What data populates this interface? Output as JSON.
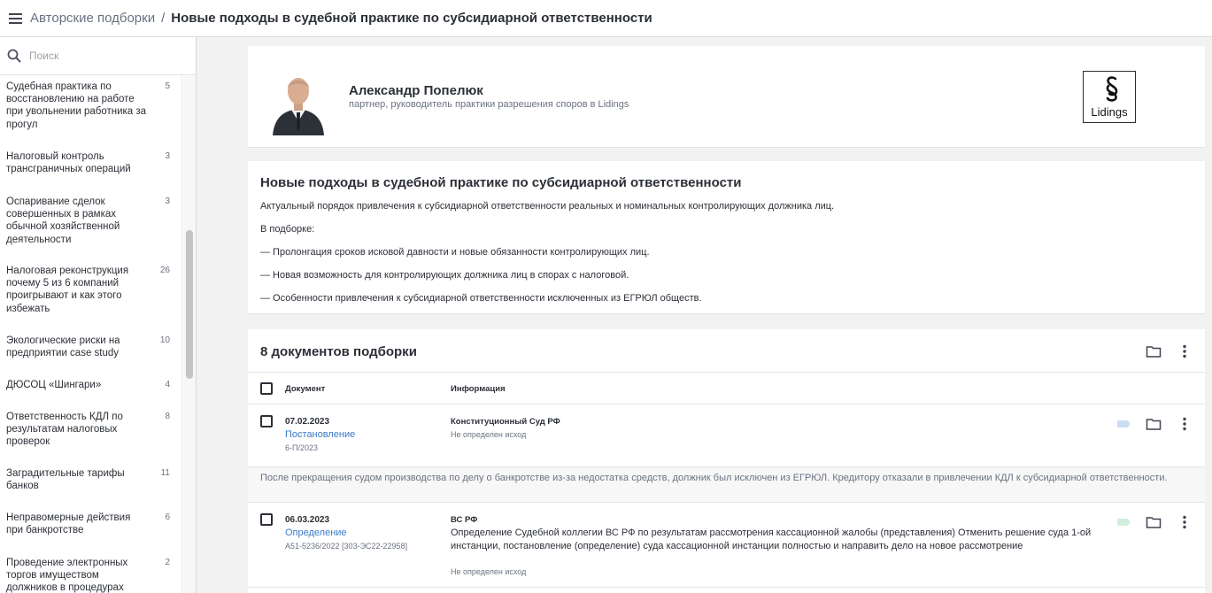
{
  "header": {
    "breadcrumb_parent": "Авторские подборки",
    "breadcrumb_sep": "/",
    "title": "Новые подходы в судебной практике по субсидиарной ответственности"
  },
  "sidebar": {
    "search_placeholder": "Поиск",
    "items": [
      {
        "label": "Судебная практика по восстановлению на работе при увольнении работника за прогул",
        "count": "5"
      },
      {
        "label": "Налоговый контроль трансграничных операций",
        "count": "3"
      },
      {
        "label": "Оспаривание сделок совершенных в рамках обычной хозяйственной деятельности",
        "count": "3"
      },
      {
        "label": "Налоговая реконструкция почему 5 из 6 компаний проигрывают и как этого избежать",
        "count": "26"
      },
      {
        "label": "Экологические риски на предприятии case study",
        "count": "10"
      },
      {
        "label": "ДЮСОЦ «Шингари»",
        "count": "4"
      },
      {
        "label": "Ответственность КДЛ по результатам налоговых проверок",
        "count": "8"
      },
      {
        "label": "Заградительные тарифы банков",
        "count": "11"
      },
      {
        "label": "Неправомерные действия при банкротстве",
        "count": "6"
      },
      {
        "label": "Проведение электронных торгов имуществом должников в процедурах",
        "count": "2"
      }
    ]
  },
  "author": {
    "name": "Александр Попелюк",
    "role": "партнер, руководитель практики разрешения споров в Lidings",
    "logo_text": "Lidings"
  },
  "description": {
    "title": "Новые подходы в судебной практике по субсидиарной ответственности",
    "lines": [
      "Актуальный порядок привлечения к субсидиарной ответственности реальных и номинальных контролирующих должника лиц.",
      "В подборке:",
      "— Пролонгация сроков исковой давности и новые обязанности контролирующих лиц.",
      "— Новая возможность для контролирующих должника лиц в спорах с налоговой.",
      "— Особенности привлечения к субсидиарной ответственности исключенных из ЕГРЮЛ обществ."
    ]
  },
  "documents": {
    "title": "8 документов подборки",
    "col_document": "Документ",
    "col_info": "Информация",
    "rows": [
      {
        "date": "07.02.2023",
        "type": "Постановление",
        "number": "6-П/2023",
        "court": "Конституционный Суд РФ",
        "info": "",
        "outcome": "Не определен исход",
        "tag_color": "#c9dbf5",
        "summary": "После прекращения судом производства по делу о банкротстве из-за недостатка средств, должник был исключен из ЕГРЮЛ. Кредитору отказали в привлечении КДЛ к субсидиарной ответственности."
      },
      {
        "date": "06.03.2023",
        "type": "Определение",
        "number": "А51-5236/2022 [303-ЭС22-22958]",
        "court": "ВС РФ",
        "info": "Определение Судебной коллегии ВС РФ по результатам рассмотрения кассационной жалобы (представления) Отменить решение суда 1-ой инстанции, постановление (определение) суда кассационной инстанции полностью и направить дело на новое рассмотрение",
        "outcome": "Не определен исход",
        "tag_color": "#cfeedd",
        "summary": ""
      }
    ]
  }
}
